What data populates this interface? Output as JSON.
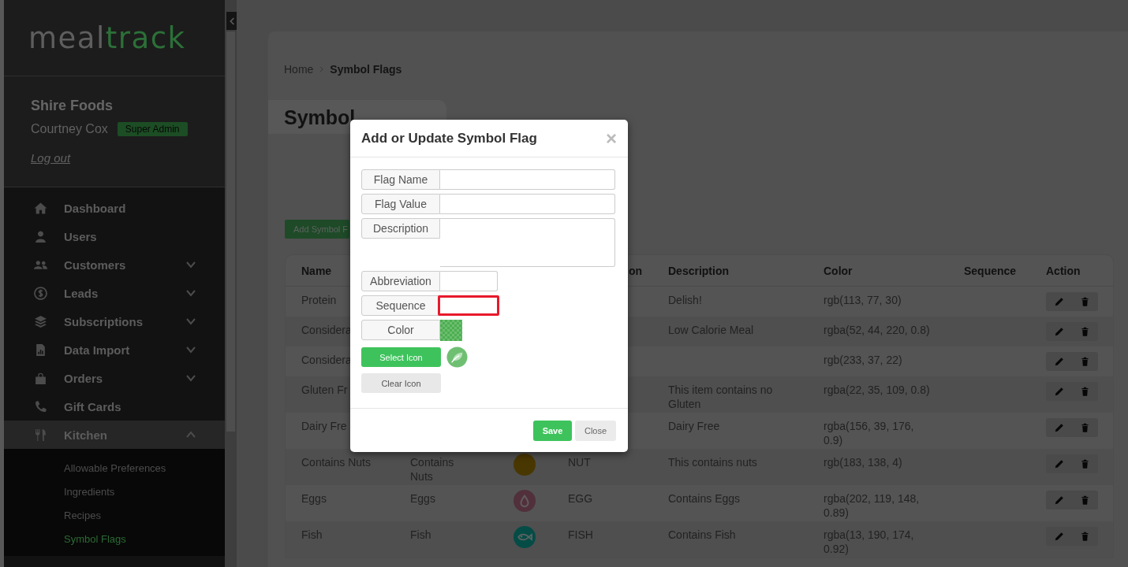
{
  "sidebar": {
    "logo": [
      "meal",
      "track"
    ],
    "profile": {
      "company": "Shire Foods",
      "user": "Courtney Cox",
      "role": "Super Admin",
      "logout": "Log out"
    },
    "nav": [
      {
        "label": "Dashboard",
        "kind": "link",
        "selected": false
      },
      {
        "label": "Users",
        "kind": "link",
        "selected": false
      },
      {
        "label": "Customers",
        "kind": "group",
        "expanded": false,
        "selected": false
      },
      {
        "label": "Leads",
        "kind": "group",
        "expanded": false,
        "selected": false
      },
      {
        "label": "Subscriptions",
        "kind": "group",
        "expanded": false,
        "selected": false
      },
      {
        "label": "Data Import",
        "kind": "group",
        "expanded": false,
        "selected": false
      },
      {
        "label": "Orders",
        "kind": "group",
        "expanded": false,
        "selected": false
      },
      {
        "label": "Gift Cards",
        "kind": "link",
        "selected": false
      },
      {
        "label": "Kitchen",
        "kind": "group",
        "expanded": true,
        "selected": true,
        "children": [
          {
            "label": "Allowable Preferences",
            "selected": false
          },
          {
            "label": "Ingredients",
            "selected": false
          },
          {
            "label": "Recipes",
            "selected": false
          },
          {
            "label": "Symbol Flags",
            "selected": true
          }
        ]
      }
    ]
  },
  "breadcrumb": [
    "Home",
    "Symbol Flags"
  ],
  "page_title": "Symbol",
  "add_button": "Add Symbol F",
  "table": {
    "columns": {
      "name": "Name",
      "column_4": "on",
      "description": "Description",
      "column_6": "Color",
      "sequence": "Sequence",
      "action": "Action"
    },
    "rows": [
      {
        "name": "Protein",
        "description": "Delish!",
        "color_value": "rgb(113, 77, 30)"
      },
      {
        "name": "Considera",
        "description": "Low Calorie Meal",
        "color_value": "rgba(52, 44, 220, 0.8)"
      },
      {
        "name": "Considera",
        "color_value": "rgb(233, 37, 22)"
      },
      {
        "name": "Gluten Fr",
        "description": "This item contains no Gluten",
        "color_value": "rgba(22, 35, 109, 0.8)"
      },
      {
        "name": "Dairy Fre",
        "description": "Dairy Free",
        "color_value": "rgba(156, 39, 176, 0.9)"
      },
      {
        "name": "Contains Nuts",
        "column_2": "Contains Nuts",
        "column_3": {
          "kind": "plain",
          "color": "#493702"
        },
        "column_4": "NUT",
        "description": "This contains nuts",
        "color_value": "rgb(183, 138, 4)"
      },
      {
        "name": "Eggs",
        "column_2": "Eggs",
        "column_3": {
          "kind": "drop",
          "color": "#51303b"
        },
        "column_4": "EGG",
        "description": "Contains Eggs",
        "color_value": "rgba(202, 119, 148, 0.89)"
      },
      {
        "name": "Fish",
        "column_2": "Fish",
        "column_3": {
          "kind": "fish",
          "color": "#054c46"
        },
        "column_4": "FISH",
        "description": "Contains Fish",
        "color_value": "rgba(13, 190, 174, 0.92)"
      }
    ]
  },
  "modal": {
    "title": "Add or Update Symbol Flag",
    "close": "×",
    "fields": [
      {
        "label": "Flag Name",
        "kind": "text",
        "error": false
      },
      {
        "label": "Flag Value",
        "kind": "text",
        "error": false
      },
      {
        "label": "Description",
        "kind": "textarea",
        "error": false
      },
      {
        "label": "Abbreviation",
        "kind": "short",
        "error": false
      },
      {
        "label": "Sequence",
        "kind": "short",
        "error": true
      },
      {
        "label": "Color",
        "kind": "color",
        "color": "#4caf50",
        "error": false
      }
    ],
    "select_icon": "Select Icon",
    "clear_icon": "Clear Icon",
    "buttons": [
      "Save",
      "Close"
    ]
  }
}
